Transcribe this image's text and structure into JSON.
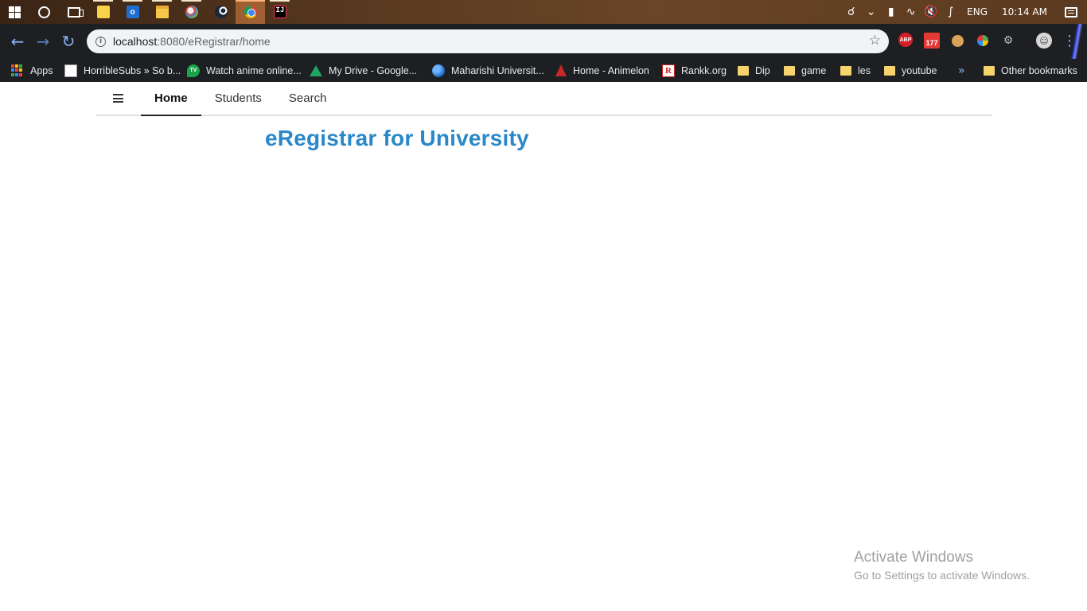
{
  "taskbar": {
    "apps": [
      {
        "name": "start",
        "icon": "windows-logo-icon"
      },
      {
        "name": "cortana",
        "icon": "cortana-icon"
      },
      {
        "name": "task-view",
        "icon": "task-view-icon"
      },
      {
        "name": "sticky-notes",
        "icon": "sticky-notes-icon"
      },
      {
        "name": "outlook",
        "icon": "outlook-icon",
        "glyph": "o"
      },
      {
        "name": "file-explorer",
        "icon": "folder-icon"
      },
      {
        "name": "paint",
        "icon": "paint-icon"
      },
      {
        "name": "steam",
        "icon": "steam-icon"
      },
      {
        "name": "chrome",
        "icon": "chrome-icon"
      },
      {
        "name": "intellij",
        "icon": "intellij-icon",
        "glyph": "IJ"
      }
    ],
    "tray": {
      "language": "ENG",
      "time": "10:14 AM"
    }
  },
  "browser": {
    "url_host": "localhost",
    "url_rest": ":8080/eRegistrar/home",
    "extensions": {
      "abp_label": "ABP",
      "calendar_badge": "177"
    }
  },
  "bookmarks": {
    "items": [
      {
        "label": "Apps",
        "icon": "apps-grid-icon"
      },
      {
        "label": "HorribleSubs » So b...",
        "icon": "horriblesubs-icon"
      },
      {
        "label": "Watch anime online...",
        "icon": "tv-icon"
      },
      {
        "label": "My Drive - Google...",
        "icon": "google-drive-icon"
      },
      {
        "label": "Maharishi Universit...",
        "icon": "globe-icon"
      },
      {
        "label": "Home - Animelon",
        "icon": "animelon-icon"
      },
      {
        "label": "Rankk.org",
        "icon": "rankk-icon"
      },
      {
        "label": "Dip",
        "icon": "folder-icon"
      },
      {
        "label": "game",
        "icon": "folder-icon"
      },
      {
        "label": "les",
        "icon": "folder-icon"
      },
      {
        "label": "youtube",
        "icon": "folder-icon"
      }
    ],
    "overflow": "»",
    "other": "Other bookmarks"
  },
  "page": {
    "nav": {
      "tabs": [
        "Home",
        "Students",
        "Search"
      ],
      "active": "Home"
    },
    "heading": "eRegistrar for University"
  },
  "watermark": {
    "line1": "Activate Windows",
    "line2": "Go to Settings to activate Windows."
  },
  "colors": {
    "heading": "#2a88c8",
    "taskbar": "#5a3a20",
    "chrome_dark": "#1e1f22"
  }
}
